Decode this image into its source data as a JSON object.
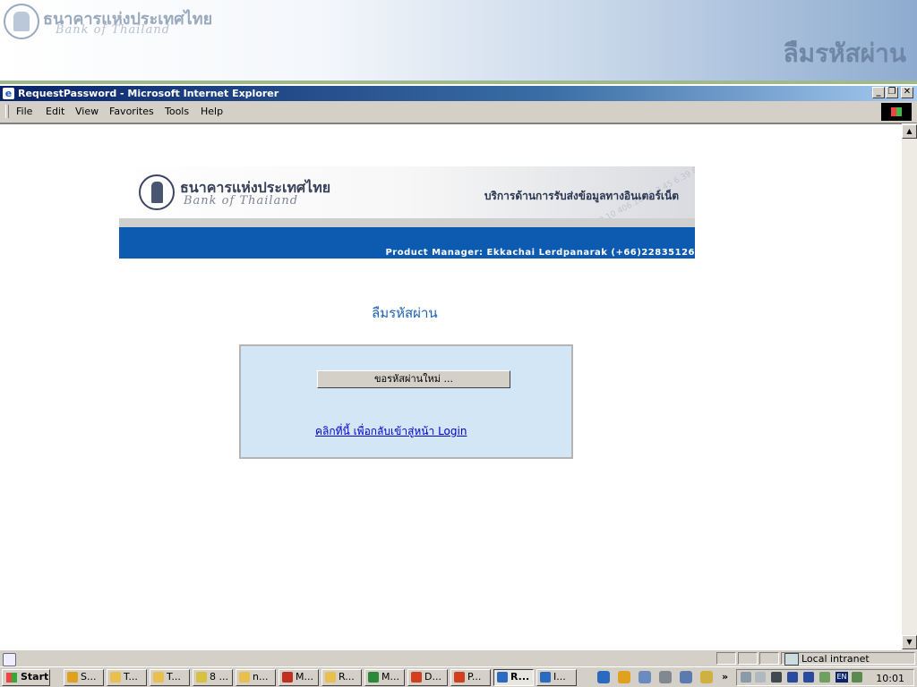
{
  "slide": {
    "bot_name_th": "ธนาคารแห่งประเทศไทย",
    "bot_name_en": "Bank of Thailand",
    "title": "ลืมรหัสผ่าน"
  },
  "window": {
    "title": "RequestPassword - Microsoft Internet Explorer",
    "minimize": "_",
    "restore": "❐",
    "close": "✕"
  },
  "menu": [
    "File",
    "Edit",
    "View",
    "Favorites",
    "Tools",
    "Help"
  ],
  "banner": {
    "bank_th": "ธนาคารแห่งประเทศไทย",
    "bank_en": "Bank of Thailand",
    "service": "บริการด้านการรับส่งข้อมูลทางอินเตอร์เน็ต",
    "product_manager": "Product Manager: Ekkachai Lerdpanarak (+66)22835126"
  },
  "page": {
    "heading": "ลืมรหัสผ่าน",
    "request_button": "ขอรหัสผ่านใหม่ ...",
    "back_link": "คลิกที่นี้ เพื่อกลับเข้าสู่หน้า Login"
  },
  "status": {
    "zone": "Local intranet"
  },
  "taskbar": {
    "start": "Start",
    "tasks": [
      {
        "label": "S...",
        "color": "#e0a020"
      },
      {
        "label": "T...",
        "color": "#e8c050"
      },
      {
        "label": "T...",
        "color": "#e8c050"
      },
      {
        "label": "8 ...",
        "color": "#d8c040"
      },
      {
        "label": "n...",
        "color": "#e8c050"
      },
      {
        "label": "M...",
        "color": "#c03020"
      },
      {
        "label": "R...",
        "color": "#e8c050"
      },
      {
        "label": "M...",
        "color": "#2a8a3a"
      },
      {
        "label": "D...",
        "color": "#d04020"
      },
      {
        "label": "P...",
        "color": "#d04020"
      },
      {
        "label": "R...",
        "color": "#2a6ac0",
        "active": true
      },
      {
        "label": "I...",
        "color": "#2a6ac0"
      }
    ],
    "overflow": "»",
    "clock": "10:01",
    "lang": "EN"
  }
}
